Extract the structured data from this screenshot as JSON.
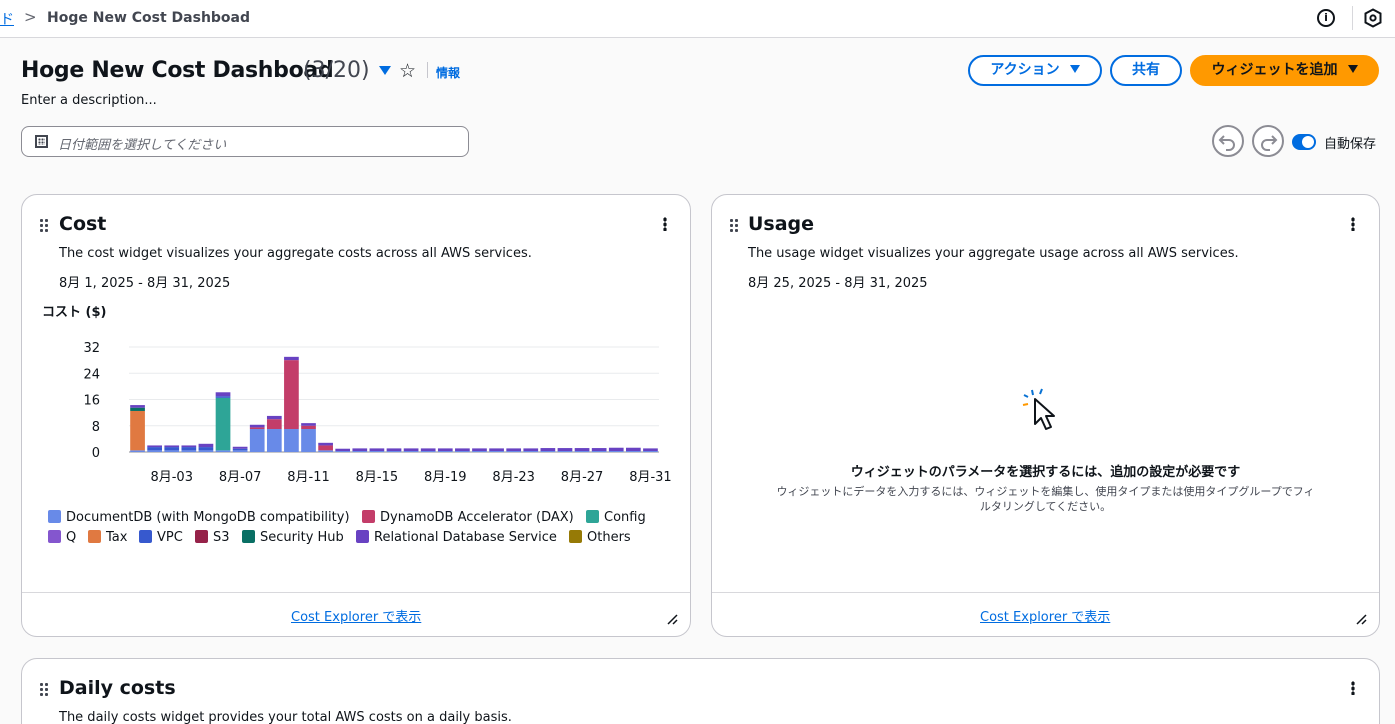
{
  "breadcrumb": {
    "prev": "ド",
    "separator": ">",
    "current": "Hoge New Cost Dashboad"
  },
  "header": {
    "title": "Hoge New Cost Dashboad",
    "count": "(3/20)",
    "info": "情報",
    "description": "Enter a description..."
  },
  "actions": {
    "actions_label": "アクション",
    "share_label": "共有",
    "add_widget_label": "ウィジェットを追加"
  },
  "date_picker": {
    "placeholder": "日付範囲を選択してください"
  },
  "autosave": {
    "label": "自動保存",
    "enabled": true
  },
  "cost_card": {
    "title": "Cost",
    "description": "The cost widget visualizes your aggregate costs across all AWS services.",
    "range": "8月 1, 2025 - 8月 31, 2025",
    "footer_link": "Cost Explorer で表示"
  },
  "usage_card": {
    "title": "Usage",
    "description": "The usage widget visualizes your aggregate usage across all AWS services.",
    "range": "8月 25, 2025 - 8月 31, 2025",
    "empty_title": "ウィジェットのパラメータを選択するには、追加の設定が必要です",
    "empty_text": "ウィジェットにデータを入力するには、ウィジェットを編集し、使用タイプまたは使用タイプグループでフィルタリングしてください。",
    "footer_link": "Cost Explorer で表示"
  },
  "daily_card": {
    "title": "Daily costs",
    "description": "The daily costs widget provides your total AWS costs on a daily basis."
  },
  "chart_data": {
    "type": "bar",
    "stacked": true,
    "ylabel": "コスト ($)",
    "ylim": [
      0,
      32
    ],
    "yticks": [
      0,
      8,
      16,
      24,
      32
    ],
    "categories": [
      "8月-01",
      "8月-02",
      "8月-03",
      "8月-04",
      "8月-05",
      "8月-06",
      "8月-07",
      "8月-08",
      "8月-09",
      "8月-10",
      "8月-11",
      "8月-12",
      "8月-13",
      "8月-14",
      "8月-15",
      "8月-16",
      "8月-17",
      "8月-18",
      "8月-19",
      "8月-20",
      "8月-21",
      "8月-22",
      "8月-23",
      "8月-24",
      "8月-25",
      "8月-26",
      "8月-27",
      "8月-28",
      "8月-29",
      "8月-30",
      "8月-31"
    ],
    "xtick_labels": [
      "8月-03",
      "8月-07",
      "8月-11",
      "8月-15",
      "8月-19",
      "8月-23",
      "8月-27",
      "8月-31"
    ],
    "grid": true,
    "legend_position": "bottom",
    "series": [
      {
        "name": "DocumentDB (with MongoDB compatibility)",
        "color": "#688ae8",
        "values": [
          0.5,
          0.5,
          0.5,
          0.5,
          0.5,
          0.5,
          0.5,
          7,
          7,
          7,
          7,
          0.5,
          0.3,
          0.3,
          0.3,
          0.3,
          0.3,
          0.3,
          0.3,
          0.3,
          0.3,
          0.3,
          0.3,
          0.3,
          0.3,
          0.3,
          0.3,
          0.3,
          0.3,
          0.3,
          0.3
        ]
      },
      {
        "name": "DynamoDB Accelerator (DAX)",
        "color": "#c33d69",
        "values": [
          0,
          0,
          0,
          0,
          0,
          0,
          0,
          0.5,
          3,
          21,
          1,
          1.5,
          0,
          0,
          0,
          0,
          0,
          0,
          0,
          0,
          0,
          0,
          0,
          0,
          0,
          0,
          0,
          0,
          0,
          0,
          0
        ]
      },
      {
        "name": "Config",
        "color": "#2ea597",
        "values": [
          0,
          0,
          0,
          0,
          0,
          16,
          0,
          0,
          0,
          0,
          0,
          0,
          0,
          0,
          0,
          0,
          0,
          0,
          0,
          0,
          0,
          0,
          0,
          0,
          0,
          0,
          0,
          0,
          0,
          0,
          0
        ]
      },
      {
        "name": "Q",
        "color": "#8456ce",
        "values": [
          0,
          0,
          0,
          0,
          0,
          0,
          0,
          0,
          0,
          0,
          0,
          0,
          0,
          0,
          0,
          0,
          0,
          0,
          0,
          0,
          0,
          0,
          0,
          0,
          0,
          0,
          0,
          0,
          0,
          0,
          0
        ]
      },
      {
        "name": "Tax",
        "color": "#e07941",
        "values": [
          12,
          0,
          0,
          0,
          0,
          0,
          0,
          0,
          0,
          0,
          0,
          0,
          0,
          0,
          0,
          0,
          0,
          0,
          0,
          0,
          0,
          0,
          0,
          0,
          0,
          0,
          0,
          0,
          0,
          0,
          0
        ]
      },
      {
        "name": "VPC",
        "color": "#3759ce",
        "values": [
          0,
          1,
          1,
          1,
          1,
          0.5,
          0.5,
          0,
          0,
          0,
          0,
          0,
          0,
          0,
          0,
          0,
          0,
          0,
          0,
          0,
          0,
          0,
          0,
          0,
          0,
          0,
          0,
          0,
          0,
          0,
          0
        ]
      },
      {
        "name": "S3",
        "color": "#962249",
        "values": [
          0,
          0,
          0,
          0,
          0,
          0,
          0,
          0,
          0,
          0,
          0,
          0,
          0,
          0,
          0,
          0,
          0,
          0,
          0,
          0,
          0,
          0,
          0,
          0,
          0,
          0,
          0,
          0,
          0,
          0,
          0
        ]
      },
      {
        "name": "Security Hub",
        "color": "#096f64",
        "values": [
          1,
          0,
          0,
          0,
          0,
          0,
          0,
          0,
          0,
          0,
          0,
          0,
          0,
          0,
          0,
          0,
          0,
          0,
          0,
          0,
          0,
          0,
          0,
          0,
          0,
          0,
          0,
          0,
          0,
          0,
          0
        ]
      },
      {
        "name": "Relational Database Service",
        "color": "#6842c2",
        "values": [
          0.8,
          0.5,
          0.5,
          0.5,
          1,
          1.2,
          0.6,
          0.8,
          1,
          1,
          0.8,
          0.8,
          0.7,
          0.8,
          0.8,
          0.8,
          0.8,
          0.8,
          0.8,
          0.8,
          0.8,
          0.8,
          0.8,
          0.8,
          0.9,
          0.9,
          0.9,
          0.9,
          1,
          1,
          0.8
        ]
      },
      {
        "name": "Others",
        "color": "#967a06",
        "values": [
          0,
          0,
          0,
          0,
          0,
          0,
          0,
          0,
          0,
          0,
          0,
          0,
          0,
          0,
          0,
          0,
          0,
          0,
          0,
          0,
          0,
          0,
          0,
          0,
          0,
          0,
          0,
          0,
          0,
          0,
          0
        ]
      }
    ]
  }
}
